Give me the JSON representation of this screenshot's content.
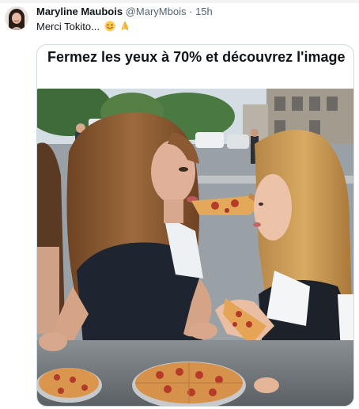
{
  "tweet": {
    "author_name": "Maryline Maubois",
    "author_handle": "@MaryMbois",
    "separator": "·",
    "time": "15h",
    "text": "Merci Tokito...",
    "emojis": [
      "smiling-face-emoji",
      "folded-hands-emoji"
    ]
  },
  "card": {
    "title": "Fermez les yeux à 70% et découvrez l'image"
  },
  "colors": {
    "text_primary": "#0f1419",
    "text_secondary": "#536471",
    "card_border": "#cfd9de"
  }
}
